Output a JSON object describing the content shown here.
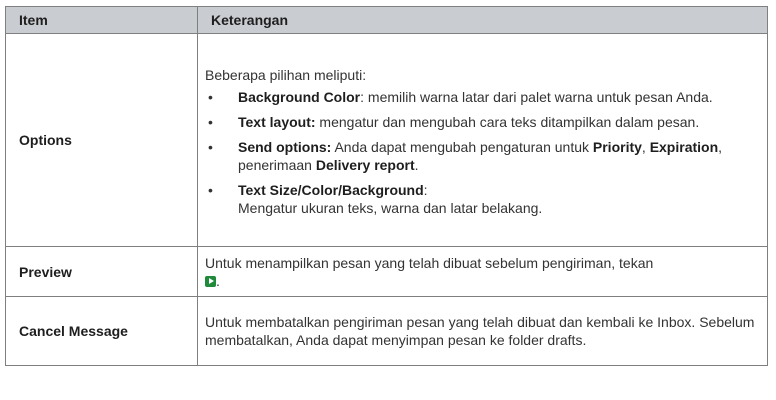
{
  "header": {
    "item": "Item",
    "desc": "Keterangan"
  },
  "options": {
    "label": "Options",
    "intro": "Beberapa pilihan meliputi:",
    "bullet": "•",
    "items": [
      {
        "bold": "Background Color",
        "rest": ": memilih warna latar dari palet warna untuk pesan Anda."
      },
      {
        "bold": "Text layout:",
        "rest": " mengatur dan mengubah cara teks ditampilkan dalam pesan."
      },
      {
        "bold": "Send options:",
        "rest": " Anda dapat mengubah pengaturan untuk ",
        "bold2": "Priority",
        "rest2": ", ",
        "bold3": "Expiration",
        "rest3": ", penerimaan ",
        "bold4": "Delivery report",
        "rest4": "."
      },
      {
        "bold": "Text Size/Color/Background",
        "rest": ":",
        "line2": "Mengatur ukuran teks, warna dan latar belakang."
      }
    ]
  },
  "preview": {
    "label": "Preview",
    "text": "Untuk menampilkan pesan yang telah dibuat sebelum pengiriman, tekan",
    "after_icon": ".",
    "icon": "play-button-icon",
    "icon_color": "#1f8a3a"
  },
  "cancel": {
    "label": "Cancel Message",
    "text": "Untuk membatalkan pengiriman pesan yang telah dibuat dan kembali ke Inbox. Sebelum membatalkan, Anda dapat menyimpan pesan ke folder drafts."
  }
}
